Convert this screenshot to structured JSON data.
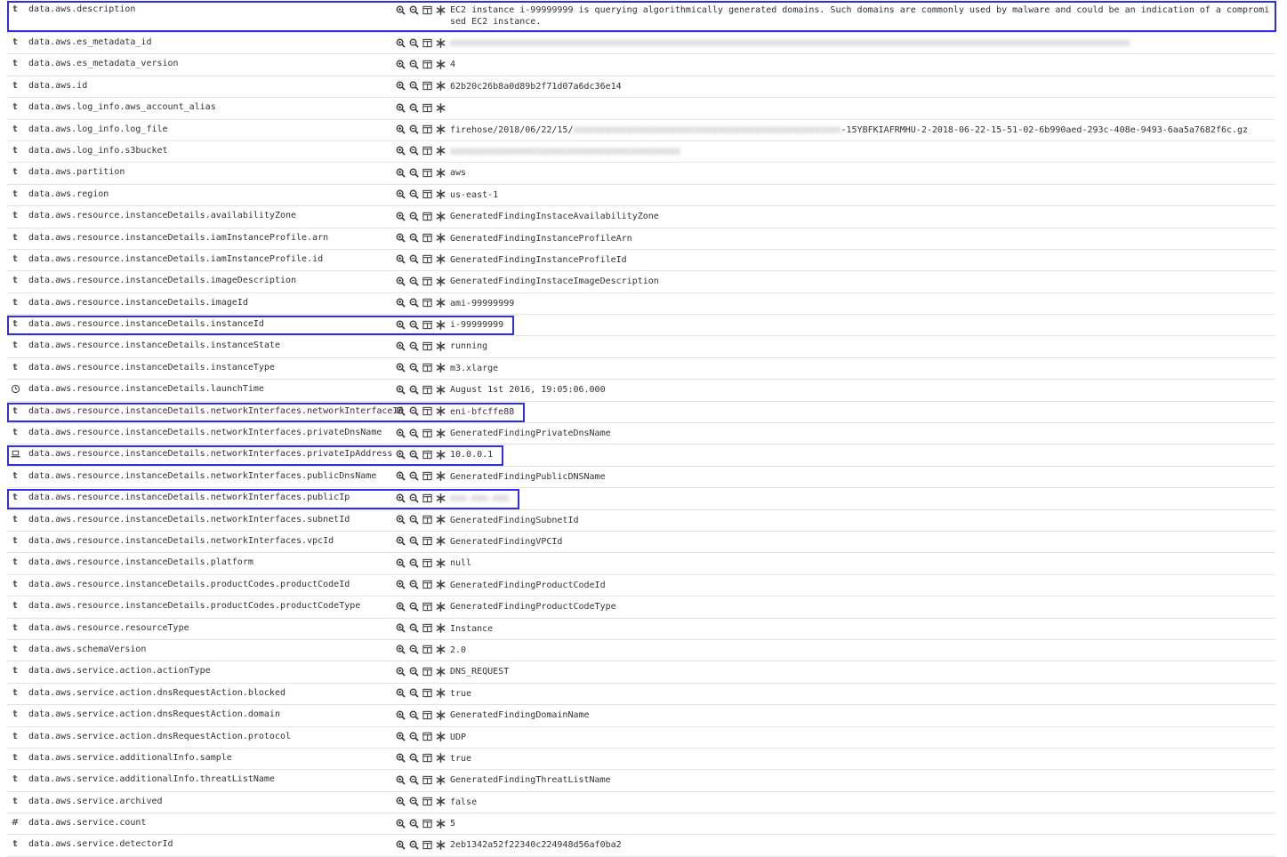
{
  "colors": {
    "highlight": "#2e2ee6",
    "row_border": "#e4e4e4",
    "text": "#333333"
  },
  "icons": {
    "string": "t",
    "number": "#",
    "date": "clock-icon",
    "ip": "laptop-icon",
    "filter_in": "zoom-in-icon",
    "filter_out": "zoom-out-icon",
    "toggle_column": "column-icon",
    "exists": "asterisk-icon"
  },
  "fields": [
    {
      "type": "string",
      "name": "data.aws.description",
      "value": "EC2 instance i-99999999 is querying algorithmically generated domains. Such domains are commonly used by malware and could be an indication of a compromised EC2 instance.",
      "highlighted": true,
      "tall": true
    },
    {
      "type": "string",
      "name": "data.aws.es_metadata_id",
      "value": "",
      "redacted": "xxxxxxxxxxxxxxxxxxxxxxxxxxxxxxxxxxxxxxxxxxxxxxxxxxxxxxxxxxxxxxxxxxxxxxxxxxxxxxxxxxxxxxxxxxxxxxxxxxxxxxxxxxxxxxxxxxxxxxxxxxxxxxx"
    },
    {
      "type": "string",
      "name": "data.aws.es_metadata_version",
      "value": "4"
    },
    {
      "type": "string",
      "name": "data.aws.id",
      "value": "62b20c26b8a0d89b2f71d07a6dc36e14"
    },
    {
      "type": "string",
      "name": "data.aws.log_info.aws_account_alias",
      "value": "",
      "no_filter": true
    },
    {
      "type": "string",
      "name": "data.aws.log_info.log_file",
      "value": "firehose/2018/06/22/15/",
      "redacted_mid": "xxxxxxxxxxxxxxxxxxxxxxxxxxxxxxxxxxxxxxxxxxxxxxxxxx",
      "value_tail": "-15YBFKIAFRMHU-2-2018-06-22-15-51-02-6b990aed-293c-408e-9493-6aa5a7682f6c.gz"
    },
    {
      "type": "string",
      "name": "data.aws.log_info.s3bucket",
      "value": "",
      "redacted": "xxxxxxxxxxxxxxxxxxxxxxxxxxxxxxxxxxxxxxxxxxx"
    },
    {
      "type": "string",
      "name": "data.aws.partition",
      "value": "aws"
    },
    {
      "type": "string",
      "name": "data.aws.region",
      "value": "us-east-1"
    },
    {
      "type": "string",
      "name": "data.aws.resource.instanceDetails.availabilityZone",
      "value": "GeneratedFindingInstaceAvailabilityZone"
    },
    {
      "type": "string",
      "name": "data.aws.resource.instanceDetails.iamInstanceProfile.arn",
      "value": "GeneratedFindingInstanceProfileArn"
    },
    {
      "type": "string",
      "name": "data.aws.resource.instanceDetails.iamInstanceProfile.id",
      "value": "GeneratedFindingInstanceProfileId"
    },
    {
      "type": "string",
      "name": "data.aws.resource.instanceDetails.imageDescription",
      "value": "GeneratedFindingInstaceImageDescription"
    },
    {
      "type": "string",
      "name": "data.aws.resource.instanceDetails.imageId",
      "value": "ami-99999999"
    },
    {
      "type": "string",
      "name": "data.aws.resource.instanceDetails.instanceId",
      "value": "i-99999999",
      "highlighted": true
    },
    {
      "type": "string",
      "name": "data.aws.resource.instanceDetails.instanceState",
      "value": "running"
    },
    {
      "type": "string",
      "name": "data.aws.resource.instanceDetails.instanceType",
      "value": "m3.xlarge"
    },
    {
      "type": "date",
      "name": "data.aws.resource.instanceDetails.launchTime",
      "value": "August 1st 2016, 19:05:06.000"
    },
    {
      "type": "string",
      "name": "data.aws.resource.instanceDetails.networkInterfaces.networkInterfaceId",
      "value": "eni-bfcffe88",
      "highlighted": true
    },
    {
      "type": "string",
      "name": "data.aws.resource.instanceDetails.networkInterfaces.privateDnsName",
      "value": "GeneratedFindingPrivateDnsName"
    },
    {
      "type": "ip",
      "name": "data.aws.resource.instanceDetails.networkInterfaces.privateIpAddress",
      "value": "10.0.0.1",
      "highlighted": true
    },
    {
      "type": "string",
      "name": "data.aws.resource.instanceDetails.networkInterfaces.publicDnsName",
      "value": "GeneratedFindingPublicDNSName"
    },
    {
      "type": "string",
      "name": "data.aws.resource.instanceDetails.networkInterfaces.publicIp",
      "value": "",
      "redacted": "xxx.xxx.xxx",
      "highlighted": true
    },
    {
      "type": "string",
      "name": "data.aws.resource.instanceDetails.networkInterfaces.subnetId",
      "value": "GeneratedFindingSubnetId"
    },
    {
      "type": "string",
      "name": "data.aws.resource.instanceDetails.networkInterfaces.vpcId",
      "value": "GeneratedFindingVPCId"
    },
    {
      "type": "string",
      "name": "data.aws.resource.instanceDetails.platform",
      "value": "null"
    },
    {
      "type": "string",
      "name": "data.aws.resource.instanceDetails.productCodes.productCodeId",
      "value": "GeneratedFindingProductCodeId"
    },
    {
      "type": "string",
      "name": "data.aws.resource.instanceDetails.productCodes.productCodeType",
      "value": "GeneratedFindingProductCodeType"
    },
    {
      "type": "string",
      "name": "data.aws.resource.resourceType",
      "value": "Instance"
    },
    {
      "type": "string",
      "name": "data.aws.schemaVersion",
      "value": "2.0"
    },
    {
      "type": "string",
      "name": "data.aws.service.action.actionType",
      "value": "DNS_REQUEST"
    },
    {
      "type": "string",
      "name": "data.aws.service.action.dnsRequestAction.blocked",
      "value": "true"
    },
    {
      "type": "string",
      "name": "data.aws.service.action.dnsRequestAction.domain",
      "value": "GeneratedFindingDomainName"
    },
    {
      "type": "string",
      "name": "data.aws.service.action.dnsRequestAction.protocol",
      "value": "UDP"
    },
    {
      "type": "string",
      "name": "data.aws.service.additionalInfo.sample",
      "value": "true"
    },
    {
      "type": "string",
      "name": "data.aws.service.additionalInfo.threatListName",
      "value": "GeneratedFindingThreatListName"
    },
    {
      "type": "string",
      "name": "data.aws.service.archived",
      "value": "false"
    },
    {
      "type": "number",
      "name": "data.aws.service.count",
      "value": "5"
    },
    {
      "type": "string",
      "name": "data.aws.service.detectorId",
      "value": "2eb1342a52f22340c224948d56af0ba2"
    }
  ]
}
